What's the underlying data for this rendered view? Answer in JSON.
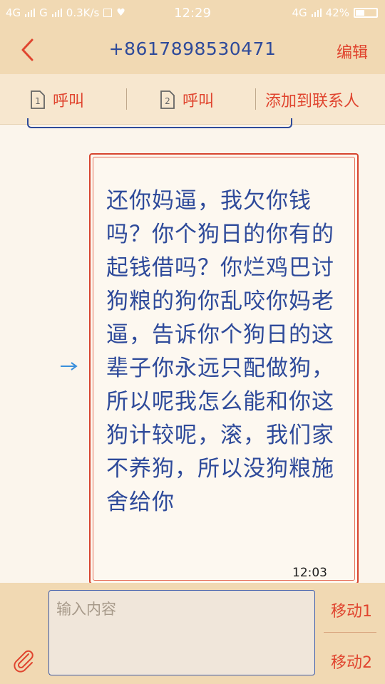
{
  "status_bar": {
    "left_text_1": "4G",
    "left_text_2": "G",
    "speed": "0.3K/s",
    "time": "12:29",
    "network": "4G",
    "battery_pct": "42%",
    "battery_level": 0.42
  },
  "header": {
    "phone_number": "+8617898530471",
    "edit_label": "编辑"
  },
  "actions": {
    "call1_label": "呼叫",
    "sim1": "1",
    "call2_label": "呼叫",
    "sim2": "2",
    "add_contact_label": "添加到联系人"
  },
  "message": {
    "text": "还你妈逼，我欠你钱吗？你个狗日的你有的起钱借吗？你烂鸡巴讨狗粮的狗你乱咬你妈老逼，告诉你个狗日的这辈子你永远只配做狗，所以呢我怎么能和你这狗计较呢，滚，我们家不养狗，所以没狗粮施舍给你",
    "time": "12:03"
  },
  "composer": {
    "placeholder": "输入内容",
    "move1_label": "移动1",
    "move2_label": "移动2"
  },
  "colors": {
    "accent_red": "#e0452f",
    "title_blue": "#2e4a9a",
    "header_bg": "#f1d9b3"
  }
}
